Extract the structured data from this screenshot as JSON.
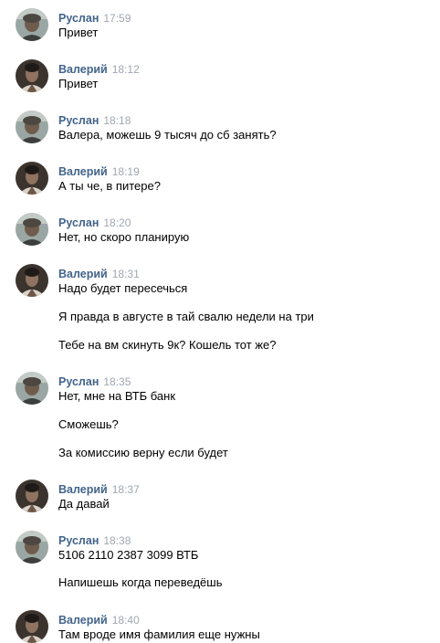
{
  "colors": {
    "author": "#42648b",
    "time": "#a0a7b1",
    "text": "#000000",
    "background": "#ffffff"
  },
  "messages": [
    {
      "author": "Руслан",
      "avatar": "ruslan-avatar",
      "time": "17:59",
      "lines": [
        "Привет"
      ]
    },
    {
      "author": "Валерий",
      "avatar": "valeriy-avatar",
      "time": "18:12",
      "lines": [
        "Привет"
      ]
    },
    {
      "author": "Руслан",
      "avatar": "ruslan-avatar",
      "time": "18:18",
      "lines": [
        "Валера, можешь 9 тысяч до сб занять?"
      ]
    },
    {
      "author": "Валерий",
      "avatar": "valeriy-avatar",
      "time": "18:19",
      "lines": [
        "А ты че, в питере?"
      ]
    },
    {
      "author": "Руслан",
      "avatar": "ruslan-avatar",
      "time": "18:20",
      "lines": [
        "Нет, но скоро планирую"
      ]
    },
    {
      "author": "Валерий",
      "avatar": "valeriy-avatar",
      "time": "18:31",
      "lines": [
        "Надо будет пересечься",
        "Я правда в августе в тай свалю недели на три",
        "Тебе на вм скинуть 9к? Кошель тот же?"
      ]
    },
    {
      "author": "Руслан",
      "avatar": "ruslan-avatar",
      "time": "18:35",
      "lines": [
        "Нет, мне на ВТБ банк",
        "Сможешь?",
        "За комиссию верну если будет"
      ]
    },
    {
      "author": "Валерий",
      "avatar": "valeriy-avatar",
      "time": "18:37",
      "lines": [
        "Да давай"
      ]
    },
    {
      "author": "Руслан",
      "avatar": "ruslan-avatar",
      "time": "18:38",
      "lines": [
        "5106 2110 2387 3099 ВТБ",
        "Напишешь когда переведёшь"
      ]
    },
    {
      "author": "Валерий",
      "avatar": "valeriy-avatar",
      "time": "18:40",
      "lines": [
        "Там вроде имя фамилия еще нужны"
      ]
    }
  ]
}
